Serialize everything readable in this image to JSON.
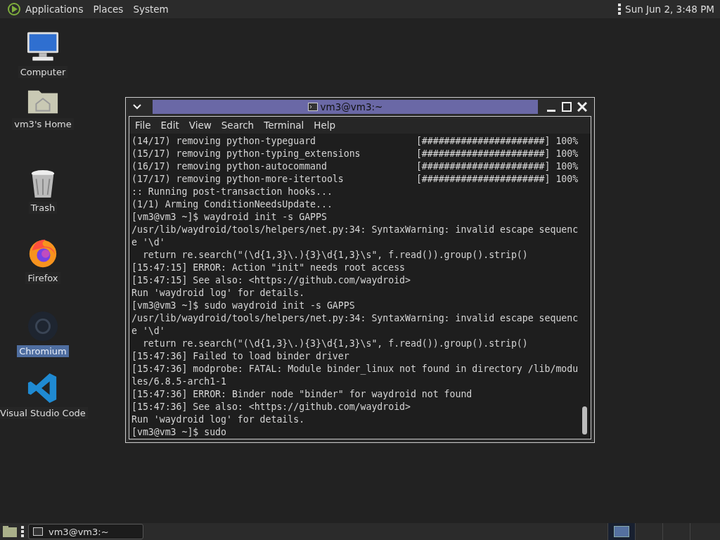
{
  "top_panel": {
    "menus": [
      "Applications",
      "Places",
      "System"
    ],
    "clock": "Sun Jun  2,  3:48 PM"
  },
  "desktop_icons": [
    {
      "kind": "computer",
      "label": "Computer",
      "selected": false
    },
    {
      "kind": "home",
      "label": "vm3's Home",
      "selected": false
    },
    {
      "kind": "trash",
      "label": "Trash",
      "selected": false
    },
    {
      "kind": "firefox",
      "label": "Firefox",
      "selected": false
    },
    {
      "kind": "chromium",
      "label": "Chromium",
      "selected": true
    },
    {
      "kind": "vscode",
      "label": "Visual Studio Code",
      "selected": false
    }
  ],
  "terminal": {
    "title": "vm3@vm3:~",
    "menus": [
      "File",
      "Edit",
      "View",
      "Search",
      "Terminal",
      "Help"
    ],
    "lines": [
      "(14/17) removing python-typeguard                  [######################] 100%",
      "(15/17) removing python-typing_extensions          [######################] 100%",
      "(16/17) removing python-autocommand                [######################] 100%",
      "(17/17) removing python-more-itertools             [######################] 100%",
      ":: Running post-transaction hooks...",
      "(1/1) Arming ConditionNeedsUpdate...",
      "[vm3@vm3 ~]$ waydroid init -s GAPPS",
      "/usr/lib/waydroid/tools/helpers/net.py:34: SyntaxWarning: invalid escape sequenc",
      "e '\\d'",
      "  return re.search(\"(\\d{1,3}\\.){3}\\d{1,3}\\s\", f.read()).group().strip()",
      "[15:47:15] ERROR: Action \"init\" needs root access",
      "[15:47:15] See also: <https://github.com/waydroid>",
      "Run 'waydroid log' for details.",
      "[vm3@vm3 ~]$ sudo waydroid init -s GAPPS",
      "/usr/lib/waydroid/tools/helpers/net.py:34: SyntaxWarning: invalid escape sequenc",
      "e '\\d'",
      "  return re.search(\"(\\d{1,3}\\.){3}\\d{1,3}\\s\", f.read()).group().strip()",
      "[15:47:36] Failed to load binder driver",
      "[15:47:36] modprobe: FATAL: Module binder_linux not found in directory /lib/modu",
      "les/6.8.5-arch1-1",
      "[15:47:36] ERROR: Binder node \"binder\" for waydroid not found",
      "[15:47:36] See also: <https://github.com/waydroid>",
      "Run 'waydroid log' for details.",
      "[vm3@vm3 ~]$ sudo"
    ]
  },
  "taskbar": {
    "windows": [
      {
        "label": "vm3@vm3:~",
        "selected": false
      }
    ],
    "workspaces": [
      {
        "selected": true
      },
      {
        "selected": false
      },
      {
        "selected": false
      },
      {
        "selected": false
      }
    ]
  }
}
